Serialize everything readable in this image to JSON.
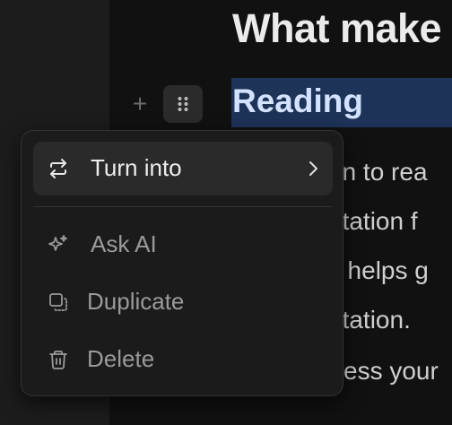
{
  "page": {
    "title": "What make",
    "heading": "Reading",
    "body_lines": [
      "on to rea",
      "ntation f",
      "t helps g",
      "ntation.",
      "ess your"
    ]
  },
  "block_actions": {
    "add_icon": "plus-icon",
    "drag_icon": "drag-handle-icon"
  },
  "menu": {
    "items": [
      {
        "label": "Turn into",
        "icon": "swap-icon",
        "has_submenu": true,
        "active": true
      },
      {
        "label": "Ask AI",
        "icon": "sparkle-icon",
        "has_submenu": false,
        "active": false
      },
      {
        "label": "Duplicate",
        "icon": "duplicate-icon",
        "has_submenu": false,
        "active": false
      },
      {
        "label": "Delete",
        "icon": "trash-icon",
        "has_submenu": false,
        "active": false
      }
    ]
  },
  "colors": {
    "background": "#111111",
    "sidebar": "#1c1c1c",
    "heading_highlight": "#1e3358",
    "heading_text": "#d3e3ff",
    "menu_bg": "#1b1b1b",
    "menu_active": "#2a2a2a"
  }
}
